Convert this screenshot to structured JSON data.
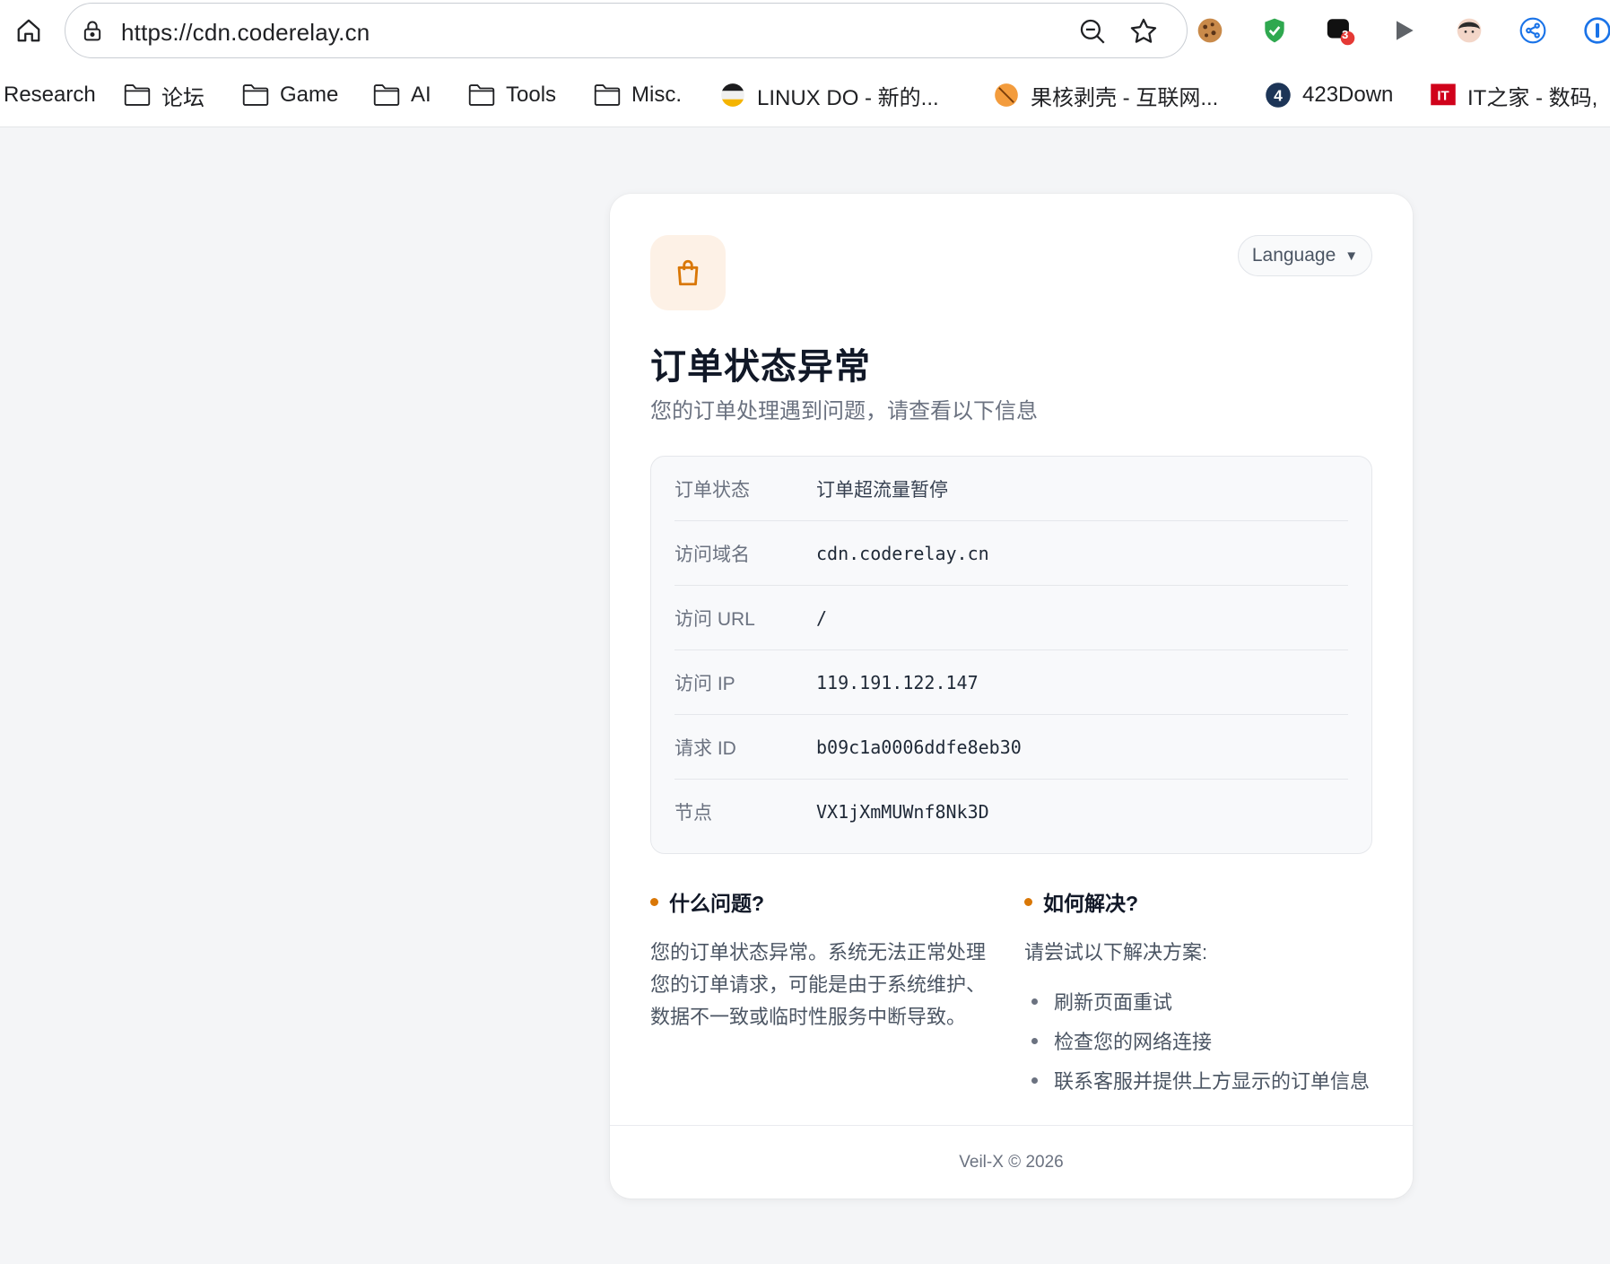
{
  "browser": {
    "url": "https://cdn.coderelay.cn",
    "extension_badge": "3",
    "bookmarks": [
      {
        "label": "Research",
        "icon": "none"
      },
      {
        "label": "论坛",
        "icon": "folder-icon"
      },
      {
        "label": "Game",
        "icon": "folder-icon"
      },
      {
        "label": "AI",
        "icon": "folder-icon"
      },
      {
        "label": "Tools",
        "icon": "folder-icon"
      },
      {
        "label": "Misc.",
        "icon": "folder-icon"
      },
      {
        "label": "LINUX DO - 新的...",
        "icon": "linuxdo-icon"
      },
      {
        "label": "果核剥壳 - 互联网...",
        "icon": "guohe-icon"
      },
      {
        "label": "423Down",
        "icon": "423down-icon"
      },
      {
        "label": "IT之家 - 数码,",
        "icon": "ithome-icon"
      }
    ]
  },
  "page": {
    "language_label": "Language",
    "title": "订单状态异常",
    "subtitle": "您的订单处理遇到问题，请查看以下信息",
    "info_rows": [
      {
        "key": "订单状态",
        "value": "订单超流量暂停"
      },
      {
        "key": "访问域名",
        "value": "cdn.coderelay.cn"
      },
      {
        "key": "访问 URL",
        "value": "/"
      },
      {
        "key": "访问 IP",
        "value": "119.191.122.147"
      },
      {
        "key": "请求 ID",
        "value": "b09c1a0006ddfe8eb30"
      },
      {
        "key": "节点",
        "value": "VX1jXmMUWnf8Nk3D"
      }
    ],
    "problem": {
      "heading": "什么问题?",
      "text": "您的订单状态异常。系统无法正常处理您的订单请求，可能是由于系统维护、数据不一致或临时性服务中断导致。"
    },
    "solution": {
      "heading": "如何解决?",
      "intro": "请尝试以下解决方案:",
      "items": [
        "刷新页面重试",
        "检查您的网络连接",
        "联系客服并提供上方显示的订单信息"
      ]
    },
    "footer": "Veil-X © 2026"
  },
  "colors": {
    "accent": "#d97706",
    "badge_bg": "#fdf1e6",
    "page_bg": "#f4f5f7"
  }
}
